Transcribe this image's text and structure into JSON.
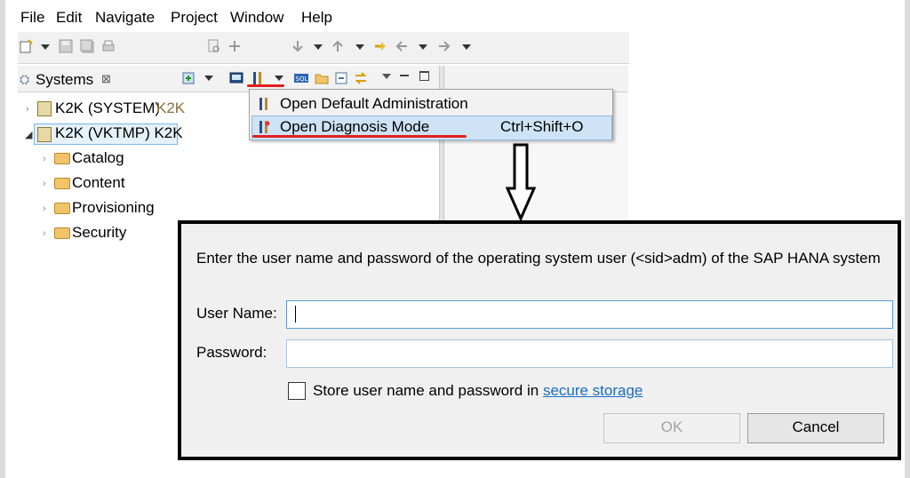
{
  "menubar": {
    "items": [
      "File",
      "Edit",
      "Navigate",
      "Project",
      "Window",
      "Help"
    ]
  },
  "systems_view": {
    "tab_label": "Systems",
    "close_glyph": "⊠",
    "tree": {
      "system1": {
        "label": "K2K (SYSTEM)",
        "suffix": "K2K"
      },
      "system2": {
        "label": "K2K (VKTMP) K2K"
      },
      "children": [
        "Catalog",
        "Content",
        "Provisioning",
        "Security"
      ]
    }
  },
  "dropdown_menu": {
    "items": [
      {
        "label": "Open Default Administration",
        "shortcut": ""
      },
      {
        "label": "Open Diagnosis Mode",
        "shortcut": "Ctrl+Shift+O"
      }
    ]
  },
  "icons": [
    "new-icon",
    "save-icon",
    "print-icon",
    "admin-tools-icon",
    "sql-icon",
    "folder-icon",
    "sync-icon",
    "minimize-icon",
    "maximize-icon",
    "back-icon",
    "forward-icon"
  ],
  "colors": {
    "accent": "#1a6dc2",
    "highlight": "#cfe3f6",
    "annotation_red": "#e02020",
    "secondary_text": "#8a6d3b"
  },
  "dialog": {
    "prompt": "Enter the user name and password of the operating system user (<sid>adm) of the SAP HANA system",
    "username_label": "User Name:",
    "username_value": "",
    "password_label": "Password:",
    "password_value": "",
    "store_label": "Store user name and password in",
    "store_link": "secure storage",
    "store_checked": false,
    "ok_label": "OK",
    "cancel_label": "Cancel"
  }
}
